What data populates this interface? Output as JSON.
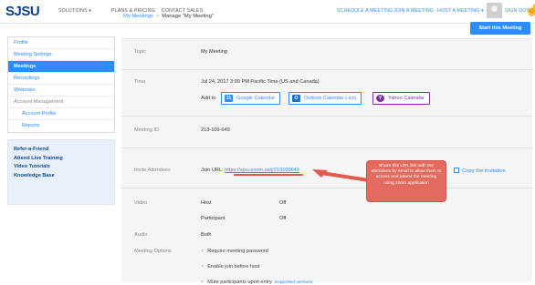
{
  "header": {
    "logo": "SJSU",
    "nav_left": [
      "SOLUTIONS ▾",
      "PLANS & PRICING",
      "CONTACT SALES"
    ],
    "nav_right": [
      "SCHEDULE A MEETING",
      "JOIN A MEETING",
      "HOST A MEETING ▾"
    ],
    "sign_out": "SIGN OUT"
  },
  "sidebar": {
    "items": [
      {
        "label": "Profile"
      },
      {
        "label": "Meeting Settings"
      },
      {
        "label": "Meetings"
      },
      {
        "label": "Recordings"
      },
      {
        "label": "Webinars"
      },
      {
        "label": "Account Management"
      },
      {
        "label": "Account Profile"
      },
      {
        "label": "Reports"
      }
    ],
    "links": [
      "Refer-a-Friend",
      "Attend Live Training",
      "Video Tutorials",
      "Knowledge Base"
    ]
  },
  "breadcrumb": {
    "parent": "My Meetings",
    "separator": ">",
    "current": "Manage \"My Meeting\""
  },
  "start_button": "Start this Meeting",
  "details": {
    "topic_label": "Topic",
    "topic": "My Meeting",
    "time_label": "Time",
    "time": "Jul 24, 2017 3:00 PM Pacific Time (US and Canada)",
    "add_to": "Add to",
    "calendars": [
      "Google Calendar",
      "Outlook Calendar (.ics)",
      "Yahoo Calendar"
    ],
    "meeting_id_label": "Meeting ID",
    "meeting_id": "213-109-649",
    "invite_label": "Invite Attendees",
    "join_url_label": "Join URL:",
    "join_url": "https://sjsu.zoom.us/j/213109649",
    "copy_invitation": "Copy the invitation",
    "video_label": "Video",
    "host_label": "Host",
    "host_value": "Off",
    "participant_label": "Participant",
    "participant_value": "Off",
    "audio_label": "Audio",
    "audio_value": "Both",
    "options_label": "Meeting Options",
    "options": [
      {
        "text": "Require meeting password"
      },
      {
        "text": "Enable join before host"
      },
      {
        "text": "Mute participants upon entry",
        "note": "Supported versions"
      }
    ]
  },
  "callout": {
    "text": "Share this URL link with the attendees by email to allow them to access and attend the meeting using zoom application",
    "color": "#e36a5f"
  },
  "colors": {
    "accent": "#2d8cff",
    "logo": "#0b3f8c"
  }
}
